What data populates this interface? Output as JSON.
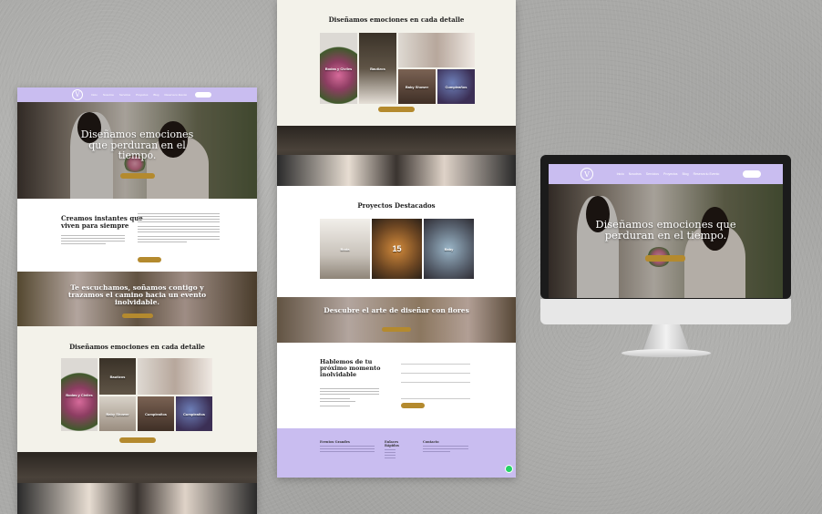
{
  "brand": {
    "logo": "V",
    "accent": "#c9bdf0",
    "gold": "#b48a2e"
  },
  "nav": {
    "items": [
      "Inicio",
      "Nosotros",
      "Servicios",
      "Proyectos",
      "Blog",
      "Reserva tu Evento"
    ],
    "cta": ""
  },
  "hero": {
    "title": "Diseñamos emociones que perduran en el tiempo.",
    "button": ""
  },
  "intro": {
    "title": "Creamos instantes que viven para siempre",
    "button": ""
  },
  "listen_band": {
    "title": "Te escuchamos, soñamos contigo y trazamos el camino hacia un evento inolvidable."
  },
  "gallery": {
    "title": "Diseñamos emociones en cada detalle",
    "tiles": [
      "Bodas y Civiles",
      "Bautizos",
      "",
      "Cumpleaños",
      "Baby Shower",
      "Cumpleaños"
    ],
    "button": ""
  },
  "projects": {
    "title": "Proyectos Destacados",
    "tiles": [
      "Boda",
      "15",
      "Baby"
    ]
  },
  "flowers_band": {
    "title": "Descubre el arte de diseñar con flores"
  },
  "contact": {
    "title": "Hablemos de tu próximo momento inolvidable"
  },
  "footer": {
    "col1": "Eventos Grandes",
    "col2": "Enlaces Rápidos",
    "col3": "Contacto"
  },
  "monitor": {
    "title": "Diseñamos emociones que perduran en el tiempo."
  }
}
